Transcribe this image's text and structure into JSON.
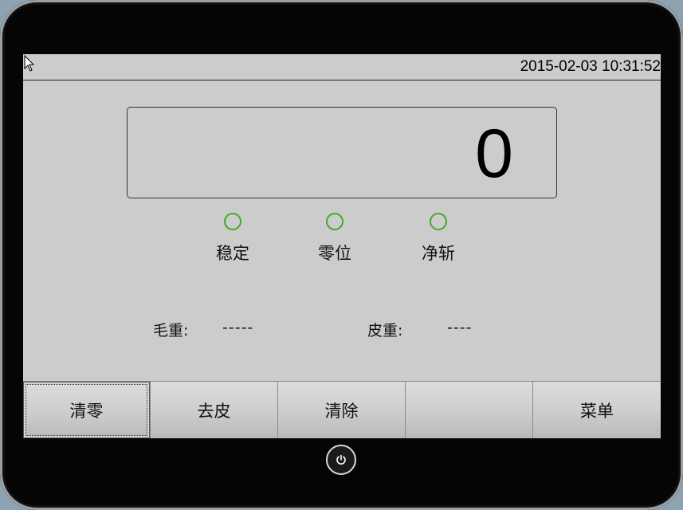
{
  "header": {
    "datetime": "2015-02-03 10:31:52"
  },
  "display": {
    "weight": "0"
  },
  "indicators": [
    {
      "label": "稳定",
      "color": "#44aa22"
    },
    {
      "label": "零位",
      "color": "#44aa22"
    },
    {
      "label": "净斩",
      "color": "#44aa22"
    }
  ],
  "fields": {
    "gross": {
      "label": "毛重:",
      "value": "-----"
    },
    "tare": {
      "label": "皮重:",
      "value": "----"
    }
  },
  "buttons": [
    {
      "label": "清零"
    },
    {
      "label": "去皮"
    },
    {
      "label": "清除"
    },
    {
      "label": ""
    },
    {
      "label": "菜单"
    }
  ]
}
